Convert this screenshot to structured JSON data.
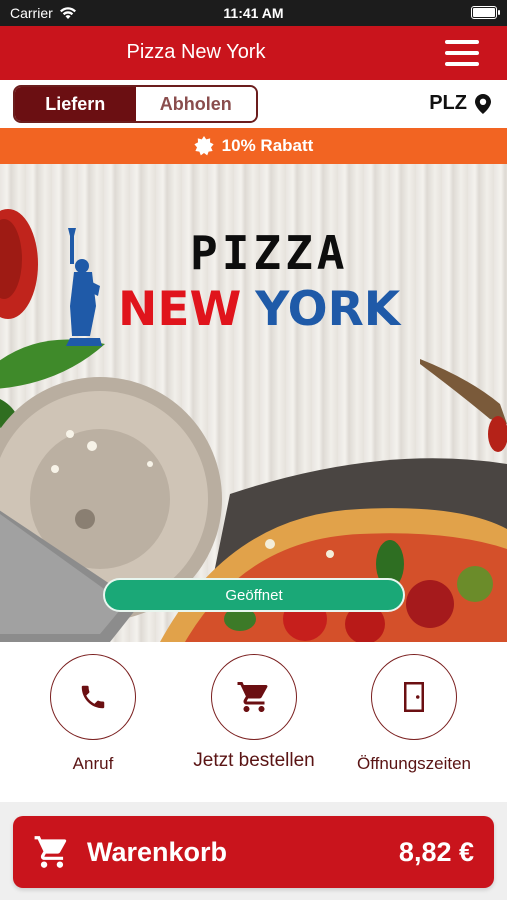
{
  "status_bar": {
    "carrier": "Carrier",
    "time": "11:41 AM"
  },
  "header": {
    "title": "Pizza New York"
  },
  "mode": {
    "deliver_label": "Liefern",
    "pickup_label": "Abholen",
    "selected": "Liefern"
  },
  "location": {
    "label": "PLZ"
  },
  "discount": {
    "label": "10% Rabatt"
  },
  "hero": {
    "logo_line1": "PIZZA",
    "logo_new": "NEW",
    "logo_york": "YORK",
    "status_label": "Geöffnet"
  },
  "actions": {
    "call_label": "Anruf",
    "order_label": "Jetzt bestellen",
    "hours_label": "Öffnungszeiten"
  },
  "cart": {
    "label": "Warenkorb",
    "total": "8,82 €"
  },
  "colors": {
    "brand_red": "#c9141c",
    "dark_red": "#6b0f12",
    "orange": "#f26422",
    "open_green": "#1aa877",
    "logo_blue": "#1f5aa8"
  }
}
